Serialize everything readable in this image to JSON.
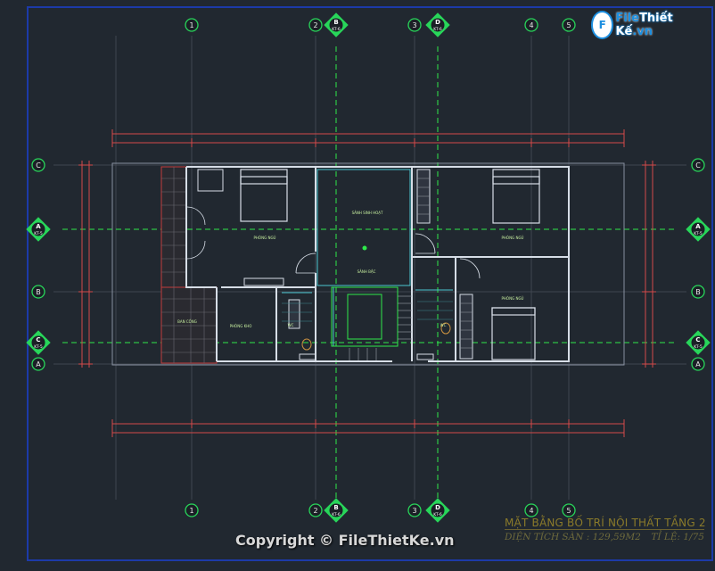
{
  "logo": {
    "badge": "F",
    "brand_a": "File",
    "brand_b": "Thiết Kế",
    "suffix": ".vn"
  },
  "title": {
    "main": "MẶT BẰNG BỐ TRÍ NỘI THẤT TẦNG 2",
    "area": "DIỆN TÍCH SÀN : 129,59M2",
    "scale": "TỈ LỆ: 1/75"
  },
  "copyright": "Copyright © FileThietKe.vn",
  "grid": {
    "vertical": [
      {
        "label": "1",
        "sheet": ""
      },
      {
        "label": "2",
        "sheet": ""
      },
      {
        "label": "B",
        "sheet": "KT-6"
      },
      {
        "label": "3",
        "sheet": ""
      },
      {
        "label": "D",
        "sheet": "KT-6"
      },
      {
        "label": "4",
        "sheet": ""
      },
      {
        "label": "5",
        "sheet": ""
      }
    ],
    "horizontal": [
      {
        "label": "C",
        "sheet": ""
      },
      {
        "label": "A",
        "sheet": "KT-5"
      },
      {
        "label": "B",
        "sheet": ""
      },
      {
        "label": "C",
        "sheet": "KT-5"
      },
      {
        "label": "A",
        "sheet": ""
      }
    ]
  },
  "rooms": [
    "PHÒNG NGỦ",
    "SẢNH SINH HOẠT",
    "PHÒNG NGỦ",
    "PHÒNG NGỦ",
    "BAN CÔNG",
    "PHÒNG KHO",
    "WC",
    "WC",
    "SẢNH BẬC"
  ],
  "colors": {
    "background": "#212830",
    "grid_line": "#3f4650",
    "grid_bubble": "#28d65a",
    "axis_dash": "#2ee84a",
    "wall": "#d6dde6",
    "dimension": "#d24a4a",
    "outline": "#c23c3c",
    "title": "#8a7a2a"
  }
}
